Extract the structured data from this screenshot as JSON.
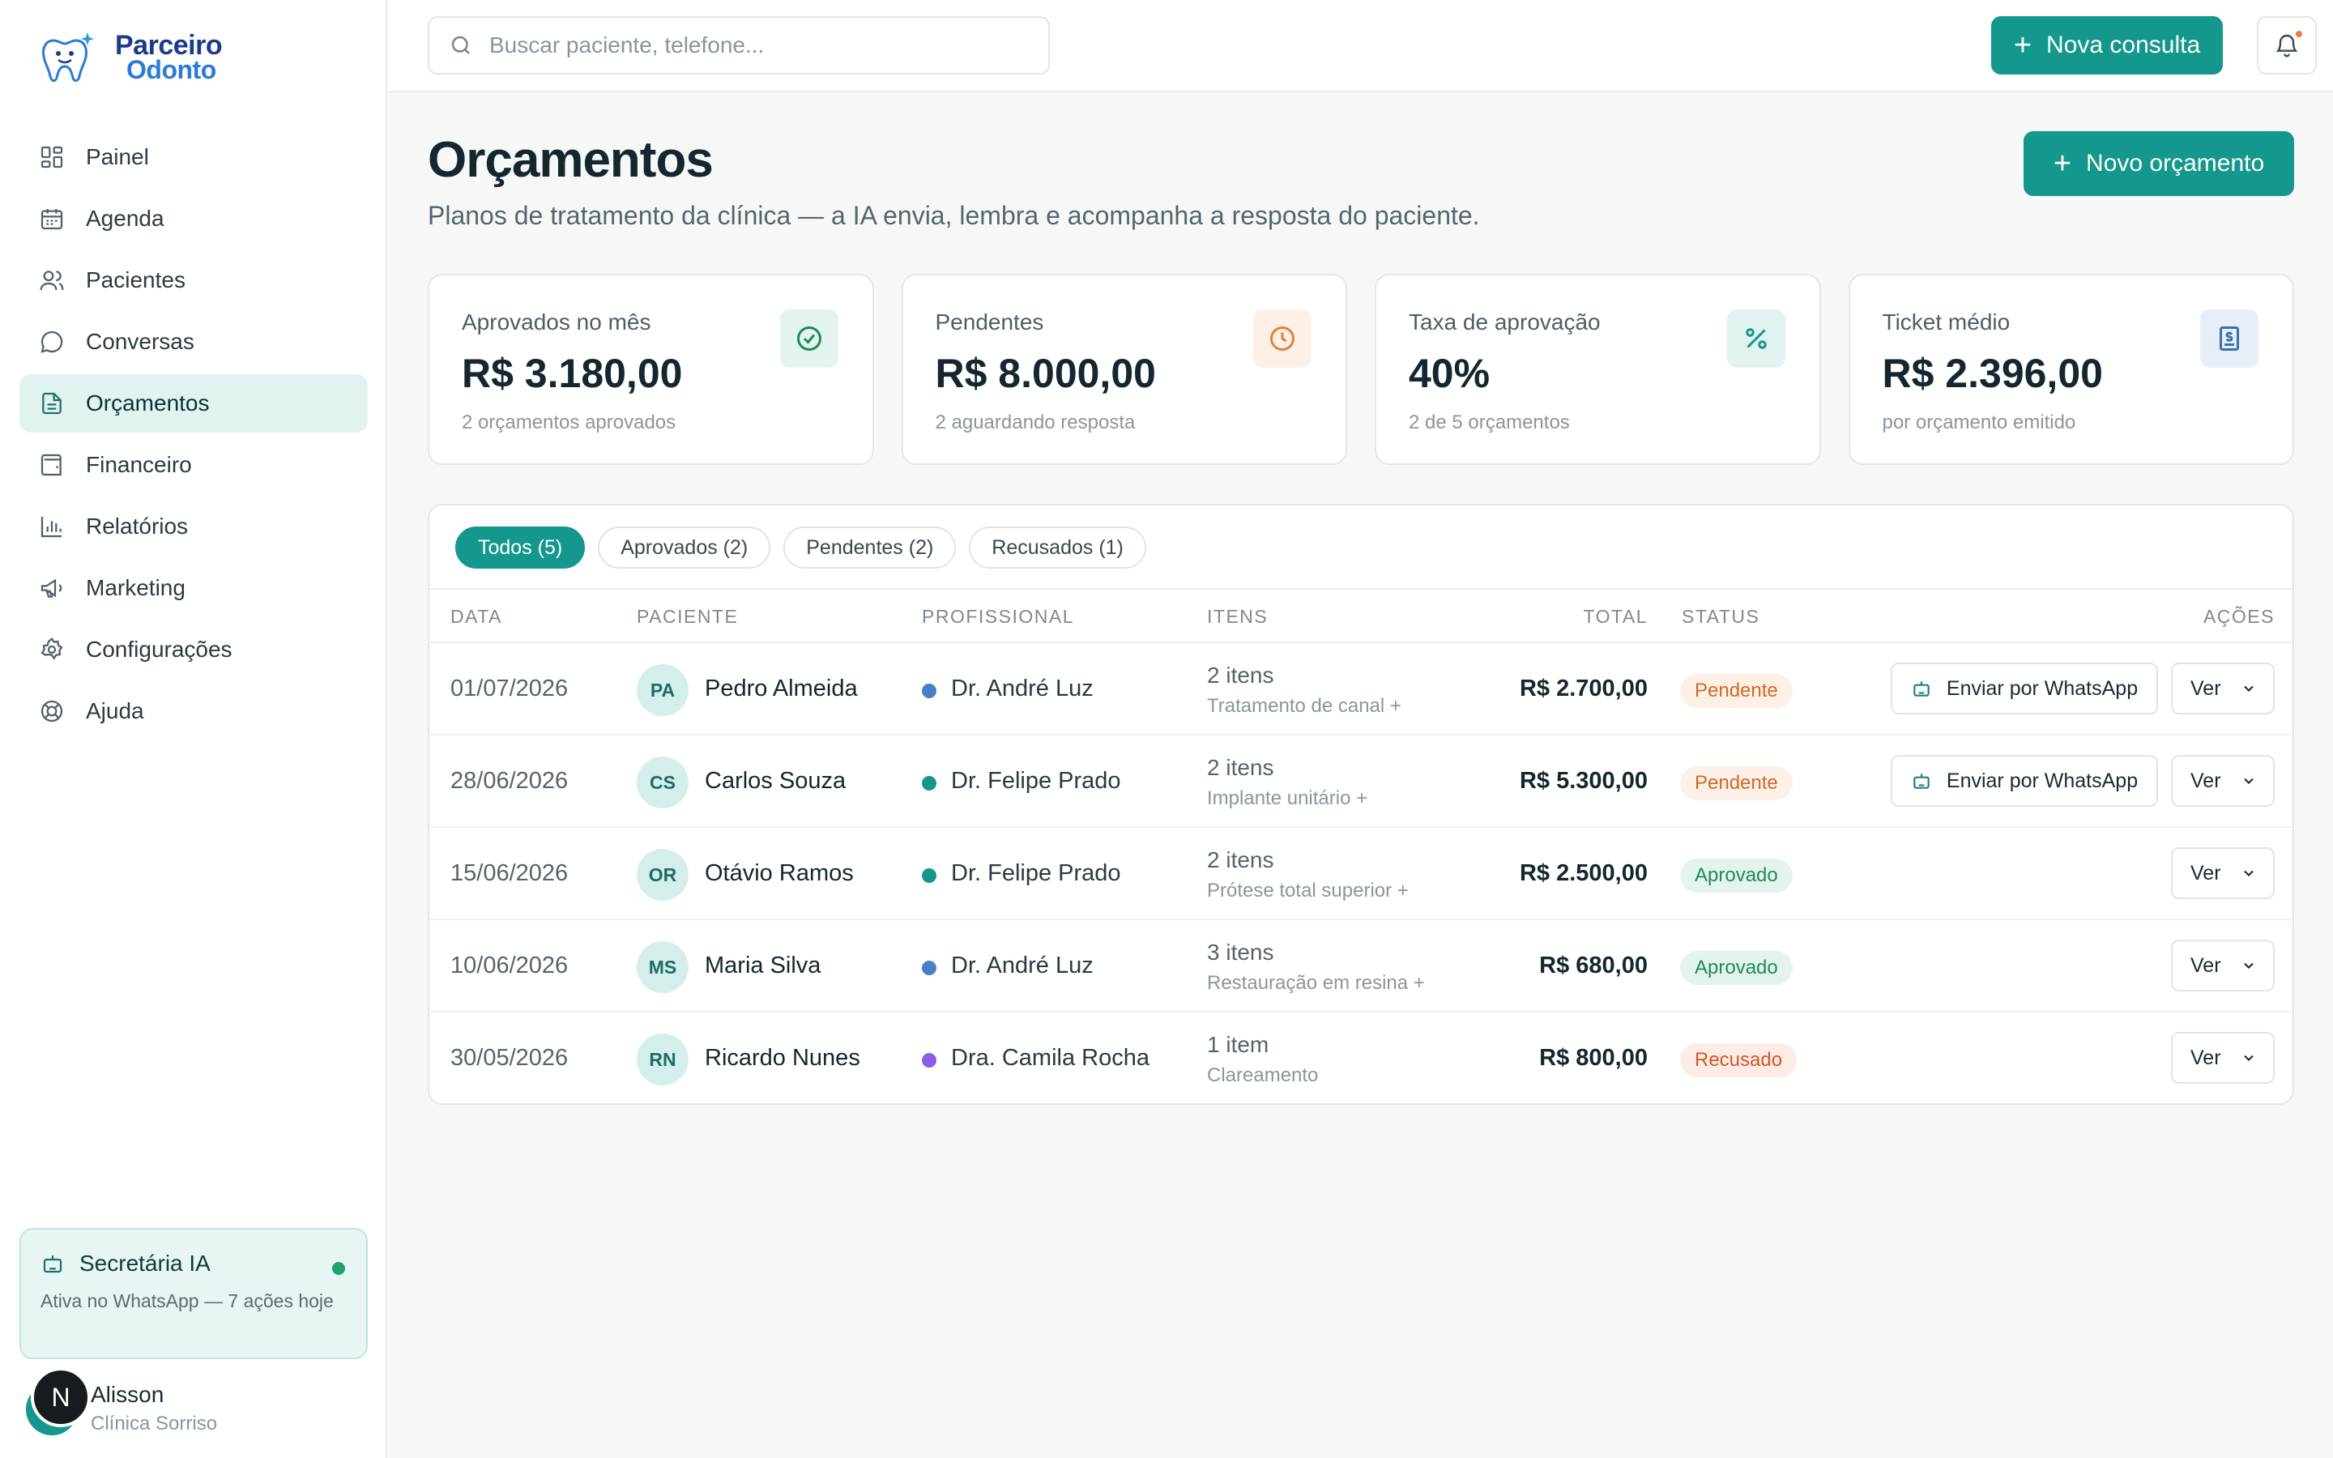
{
  "app": {
    "logo_line1": "Parceiro",
    "logo_line2": "Odonto"
  },
  "sidebar": {
    "items": [
      {
        "label": "Painel",
        "icon": "grid-icon"
      },
      {
        "label": "Agenda",
        "icon": "calendar-icon"
      },
      {
        "label": "Pacientes",
        "icon": "users-icon"
      },
      {
        "label": "Conversas",
        "icon": "chat-icon"
      },
      {
        "label": "Orçamentos",
        "icon": "file-icon",
        "active": true
      },
      {
        "label": "Financeiro",
        "icon": "wallet-icon"
      },
      {
        "label": "Relatórios",
        "icon": "bar-chart-icon"
      },
      {
        "label": "Marketing",
        "icon": "megaphone-icon"
      },
      {
        "label": "Configurações",
        "icon": "gear-icon"
      },
      {
        "label": "Ajuda",
        "icon": "lifebuoy-icon"
      }
    ],
    "ai_card": {
      "title": "Secretária IA",
      "subtitle": "Ativa no WhatsApp — 7 ações hoje",
      "status_color": "#1fa36a"
    },
    "user": {
      "initial": "N",
      "name": "Alisson",
      "clinic": "Clínica Sorriso"
    }
  },
  "topbar": {
    "search_placeholder": "Buscar paciente, telefone...",
    "new_appointment": "Nova consulta"
  },
  "page": {
    "title": "Orçamentos",
    "subtitle": "Planos de tratamento da clínica — a IA envia, lembra e acompanha a resposta do paciente.",
    "new_button": "Novo orçamento"
  },
  "stats": [
    {
      "label": "Aprovados no mês",
      "value": "R$ 3.180,00",
      "note": "2 orçamentos aprovados",
      "icon": "check-circle-icon",
      "color": "#1f8a5a",
      "bg": "#e3f4ec"
    },
    {
      "label": "Pendentes",
      "value": "R$ 8.000,00",
      "note": "2 aguardando resposta",
      "icon": "clock-icon",
      "color": "#e0823a",
      "bg": "#fdf0e6"
    },
    {
      "label": "Taxa de aprovação",
      "value": "40%",
      "note": "2 de 5 orçamentos",
      "icon": "percent-icon",
      "color": "#14978c",
      "bg": "#e1f3f1"
    },
    {
      "label": "Ticket médio",
      "value": "R$ 2.396,00",
      "note": "por orçamento emitido",
      "icon": "receipt-icon",
      "color": "#3d6fb0",
      "bg": "#e6eef8"
    }
  ],
  "filters": [
    {
      "label": "Todos (5)",
      "active": true
    },
    {
      "label": "Aprovados (2)"
    },
    {
      "label": "Pendentes (2)"
    },
    {
      "label": "Recusados (1)"
    }
  ],
  "table": {
    "headers": {
      "date": "DATA",
      "patient": "PACIENTE",
      "professional": "PROFISSIONAL",
      "items": "ITENS",
      "total": "TOTAL",
      "status": "STATUS",
      "actions": "AÇÕES"
    },
    "whatsapp_label": "Enviar por WhatsApp",
    "view_label": "Ver",
    "rows": [
      {
        "date": "01/07/2026",
        "initials": "PA",
        "patient": "Pedro Almeida",
        "professional": "Dr. André Luz",
        "pro_color": "#4a7fc8",
        "items": "2 itens",
        "items_detail": "Tratamento de canal +",
        "total": "R$ 2.700,00",
        "status": "Pendente",
        "status_type": "pending",
        "whatsapp": true
      },
      {
        "date": "28/06/2026",
        "initials": "CS",
        "patient": "Carlos Souza",
        "professional": "Dr. Felipe Prado",
        "pro_color": "#14978c",
        "items": "2 itens",
        "items_detail": "Implante unitário +",
        "total": "R$ 5.300,00",
        "status": "Pendente",
        "status_type": "pending",
        "whatsapp": true
      },
      {
        "date": "15/06/2026",
        "initials": "OR",
        "patient": "Otávio Ramos",
        "professional": "Dr. Felipe Prado",
        "pro_color": "#14978c",
        "items": "2 itens",
        "items_detail": "Prótese total superior +",
        "total": "R$ 2.500,00",
        "status": "Aprovado",
        "status_type": "approved",
        "whatsapp": false
      },
      {
        "date": "10/06/2026",
        "initials": "MS",
        "patient": "Maria Silva",
        "professional": "Dr. André Luz",
        "pro_color": "#4a7fc8",
        "items": "3 itens",
        "items_detail": "Restauração em resina +",
        "total": "R$ 680,00",
        "status": "Aprovado",
        "status_type": "approved",
        "whatsapp": false
      },
      {
        "date": "30/05/2026",
        "initials": "RN",
        "patient": "Ricardo Nunes",
        "professional": "Dra. Camila Rocha",
        "pro_color": "#8b5ce6",
        "items": "1 item",
        "items_detail": "Clareamento",
        "total": "R$ 800,00",
        "status": "Recusado",
        "status_type": "refused",
        "whatsapp": false
      }
    ]
  }
}
